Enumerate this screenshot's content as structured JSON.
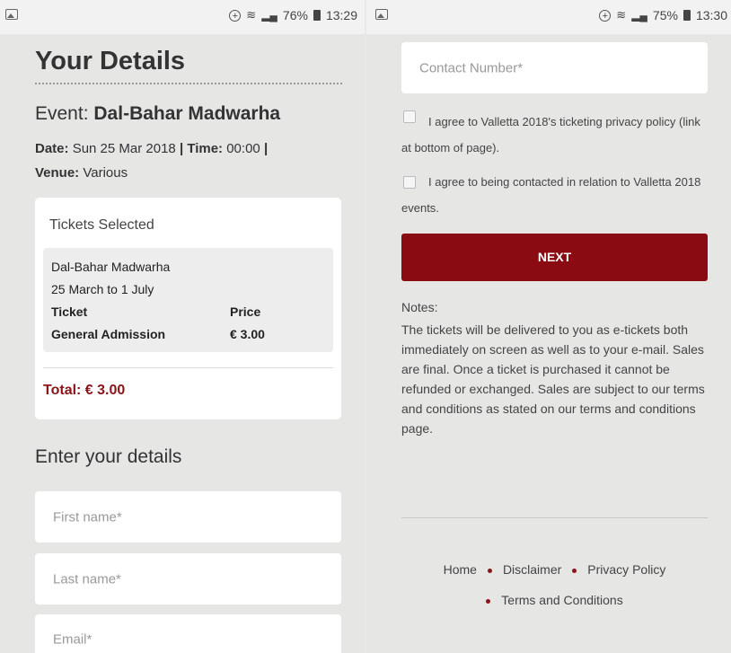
{
  "left_status": {
    "time": "13:29",
    "battery": "76%"
  },
  "right_status": {
    "time": "13:30",
    "battery": "75%"
  },
  "details": {
    "title": "Your Details",
    "event_prefix": "Event:",
    "event_name": "Dal-Bahar Madwarha",
    "date_label": "Date:",
    "date_value": "Sun 25 Mar 2018",
    "time_label": "Time:",
    "time_value": "00:00",
    "venue_label": "Venue:",
    "venue_value": "Various"
  },
  "tickets": {
    "heading": "Tickets Selected",
    "event_name": "Dal-Bahar Madwarha",
    "dates": "25 March to 1 July",
    "col_ticket": "Ticket",
    "col_price": "Price",
    "ticket_type": "General Admission",
    "ticket_price": "€ 3.00",
    "total": "Total: € 3.00"
  },
  "form": {
    "heading": "Enter your details",
    "first_name_placeholder": "First name*",
    "last_name_placeholder": "Last name*",
    "email_placeholder": "Email*",
    "contact_placeholder": "Contact Number*",
    "agree_privacy": "I agree to Valletta 2018's ticketing privacy policy (link at bottom of page).",
    "agree_contact": "I agree to being contacted in relation to Valletta 2018 events.",
    "next_label": "NEXT"
  },
  "notes": {
    "heading": "Notes:",
    "body": "The tickets will be delivered to you as e-tickets both immediately on screen as well as to your e-mail. Sales are final. Once a ticket is purchased it cannot be refunded or exchanged. Sales are subject to our terms and conditions as stated on our terms and conditions page."
  },
  "footer": {
    "links": [
      "Home",
      "Disclaimer",
      "Privacy Policy",
      "Terms and Conditions"
    ],
    "accent_color": "#8a1419"
  },
  "colors": {
    "button": "#8a0c12",
    "total_text": "#8a1419",
    "background": "#e6e6e5"
  }
}
